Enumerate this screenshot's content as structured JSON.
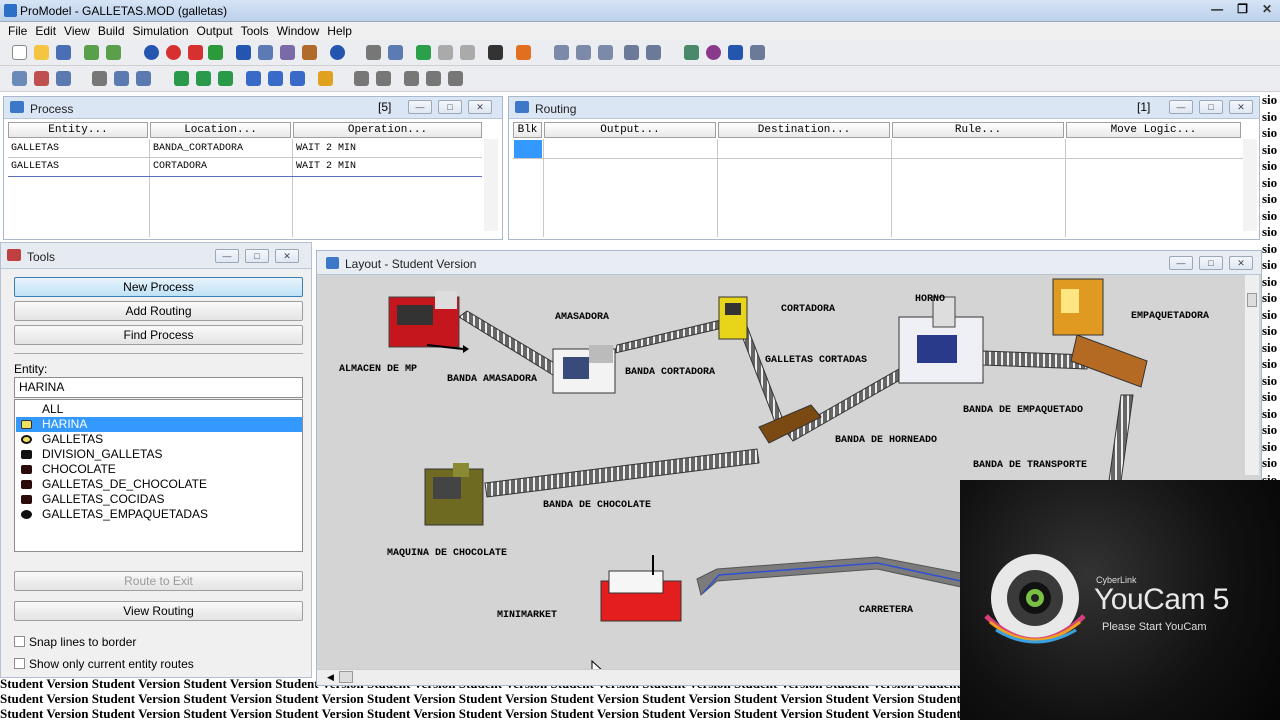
{
  "window": {
    "title": "ProModel - GALLETAS.MOD (galletas)"
  },
  "menu": [
    "File",
    "Edit",
    "View",
    "Build",
    "Simulation",
    "Output",
    "Tools",
    "Window",
    "Help"
  ],
  "process_panel": {
    "title": "Process",
    "count": "[5]",
    "columns": [
      "Entity...",
      "Location...",
      "Operation..."
    ],
    "rows": [
      {
        "entity": "GALLETAS",
        "location": "BANDA_CORTADORA",
        "operation": "WAIT 2 MIN"
      },
      {
        "entity": "GALLETAS",
        "location": "CORTADORA",
        "operation": "WAIT 2 MIN"
      }
    ]
  },
  "routing_panel": {
    "title": "Routing",
    "count": "[1]",
    "columns": [
      "Blk",
      "Output...",
      "Destination...",
      "Rule...",
      "Move Logic..."
    ]
  },
  "tools_panel": {
    "title": "Tools",
    "new_process": "New Process",
    "add_routing": "Add Routing",
    "find_process": "Find Process",
    "entity_label": "Entity:",
    "entity_value": "HARINA",
    "entities": [
      "ALL",
      "HARINA",
      "GALLETAS",
      "DIVISION_GALLETAS",
      "CHOCOLATE",
      "GALLETAS_DE_CHOCOLATE",
      "GALLETAS_COCIDAS",
      "GALLETAS_EMPAQUETADAS"
    ],
    "selected_entity": "HARINA",
    "route_to_exit": "Route to Exit",
    "view_routing": "View Routing",
    "snap_lines": "Snap lines to border",
    "show_only": "Show only current entity routes"
  },
  "layout_panel": {
    "title": "Layout - Student Version",
    "labels": {
      "almacen": "ALMACEN DE MP",
      "amasadora": "AMASADORA",
      "banda_amasadora": "BANDA AMASADORA",
      "cortadora": "CORTADORA",
      "banda_cortadora": "BANDA CORTADORA",
      "galletas_cortadas": "GALLETAS CORTADAS",
      "horno": "HORNO",
      "empaquetadora": "EMPAQUETADORA",
      "banda_empaquetado": "BANDA DE EMPAQUETADO",
      "banda_horneado": "BANDA DE HORNEADO",
      "banda_transporte": "BANDA DE TRANSPORTE",
      "banda_chocolate": "BANDA DE CHOCOLATE",
      "maquina_chocolate": "MAQUINA DE CHOCOLATE",
      "minimarket": "MINIMARKET",
      "carretera": "CARRETERA"
    }
  },
  "watermark": "Student Version",
  "youcam": {
    "brand": "CyberLink",
    "name": "YouCam 5",
    "subtitle": "Please Start YouCam"
  }
}
